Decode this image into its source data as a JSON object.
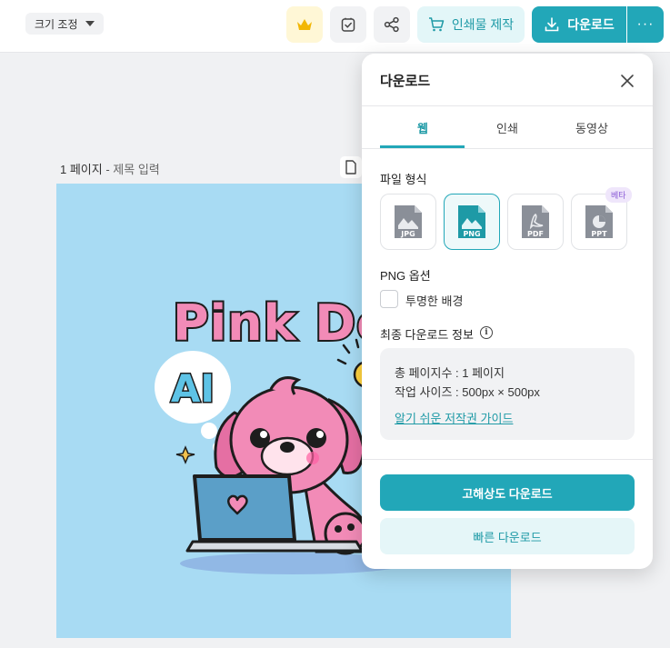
{
  "topbar": {
    "resize_label": "크기 조정",
    "print_label": "인쇄물 제작",
    "download_label": "다운로드",
    "more_label": "···"
  },
  "page": {
    "number_label": "1 페이지",
    "separator": " - ",
    "title_placeholder": "제목 입력"
  },
  "artwork": {
    "headline": "Pink Dog",
    "bubble_text": "AI"
  },
  "panel": {
    "title": "다운로드",
    "tabs": [
      {
        "label": "웹",
        "active": true
      },
      {
        "label": "인쇄",
        "active": false
      },
      {
        "label": "동영상",
        "active": false
      }
    ],
    "file_format_label": "파일 형식",
    "formats": [
      {
        "label": "JPG",
        "selected": false
      },
      {
        "label": "PNG",
        "selected": true
      },
      {
        "label": "PDF",
        "selected": false
      },
      {
        "label": "PPT",
        "selected": false
      }
    ],
    "beta_badge": "베타",
    "png_options_label": "PNG 옵션",
    "transparent_bg_label": "투명한 배경",
    "final_info_label": "최종 다운로드 정보",
    "info_icon_text": "i",
    "info_lines": {
      "total_pages": "총 페이지수 : 1 페이지",
      "work_size": "작업 사이즈 : 500px × 500px"
    },
    "guide_link": "알기 쉬운 저작권 가이드",
    "hq_download_label": "고해상도 다운로드",
    "quick_download_label": "빠른 다운로드"
  },
  "colors": {
    "accent": "#22a7b8",
    "canvas_bg": "#a8dbf3",
    "dog_pink": "#f28bb7"
  }
}
